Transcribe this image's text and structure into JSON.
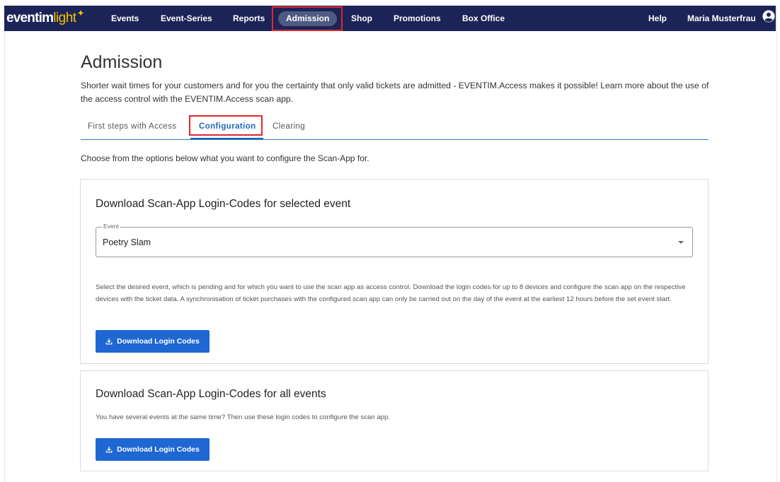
{
  "brand": {
    "name_main": "eventim",
    "name_light": "light",
    "star": "✦"
  },
  "nav": {
    "items": [
      {
        "label": "Events"
      },
      {
        "label": "Event-Series"
      },
      {
        "label": "Reports"
      },
      {
        "label": "Admission"
      },
      {
        "label": "Shop"
      },
      {
        "label": "Promotions"
      },
      {
        "label": "Box Office"
      }
    ],
    "help": "Help",
    "user": "Maria Musterfrau",
    "active_item": "Admission"
  },
  "page": {
    "title": "Admission",
    "intro": "Shorter wait times for your customers and for you the certainty that only valid tickets are admitted - EVENTIM.Access makes it possible! Learn more about the use of the access control with the EVENTIM.Access scan app."
  },
  "tabs": [
    {
      "label": "First steps with Access"
    },
    {
      "label": "Configuration",
      "active": true
    },
    {
      "label": "Clearing"
    }
  ],
  "choose_text": "Choose from the options below what you want to configure the Scan-App for.",
  "card_selected": {
    "title": "Download Scan-App Login-Codes for selected event",
    "select_label": "Event",
    "select_value": "Poetry Slam",
    "description": "Select the desired event, which is pending and for which you want to use the scan app as access control. Download the login codes for up to 8 devices and configure the scan app on the respective devices with the ticket data. A synchronisation of ticket purchases with the configured scan app can only be carried out on the day of the event at the earliest 12 hours before the set event start.",
    "button_label": "Download Login Codes"
  },
  "card_all": {
    "title": "Download Scan-App Login-Codes for all events",
    "description": "You have several events at the same time? Then use these login codes to configure the scan app.",
    "button_label": "Download Login Codes"
  },
  "colors": {
    "navbar": "#1c2457",
    "accent": "#1f67d2",
    "highlight": "#e3262c",
    "logo_yellow": "#f5c400"
  }
}
